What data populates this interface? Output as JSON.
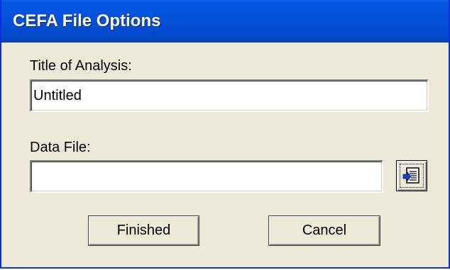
{
  "window": {
    "title": "CEFA File Options"
  },
  "form": {
    "title_label": "Title of Analysis:",
    "title_value": "Untitled",
    "data_file_label": "Data File:",
    "data_file_value": ""
  },
  "buttons": {
    "browse_icon": "open-file-icon",
    "finished_label": "Finished",
    "cancel_label": "Cancel"
  },
  "colors": {
    "titlebar": "#0452dc",
    "dialog_background": "#ece9d8",
    "title_text": "#ffffff"
  }
}
